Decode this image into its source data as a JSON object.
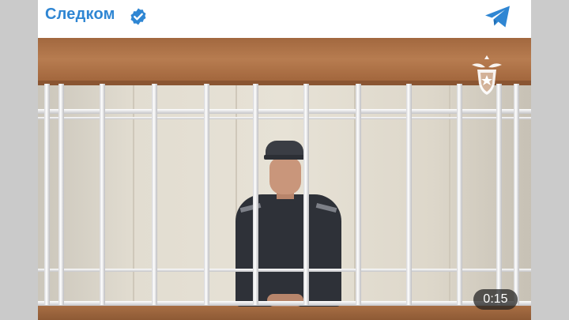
{
  "post": {
    "channel_name": "Следком",
    "verified_icon": "verified-badge-icon",
    "share_icon": "telegram-icon",
    "brand_color": "#2f86d3"
  },
  "video": {
    "duration": "0:15",
    "emblem_icon": "investigative-committee-emblem-icon"
  }
}
